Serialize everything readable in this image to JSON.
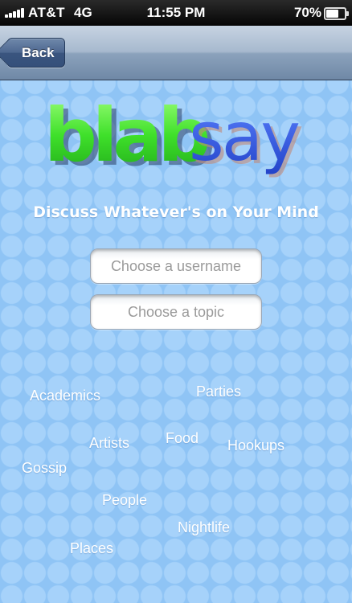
{
  "status_bar": {
    "carrier": "AT&T",
    "network": "4G",
    "time": "11:55 PM",
    "battery_percent": "70%",
    "battery_level": 0.7,
    "signal_bars": 5
  },
  "nav": {
    "back_label": "Back"
  },
  "logo": {
    "part1": "blab",
    "part2": "say",
    "colors": {
      "blab": "#3fe02a",
      "say": "#2f5ce0",
      "shadow": "#2a3f66"
    }
  },
  "tagline": "Discuss Whatever's on Your Mind",
  "form": {
    "username_placeholder": "Choose a username",
    "topic_placeholder": "Choose a topic"
  },
  "topics": [
    "Academics",
    "Parties",
    "Artists",
    "Food",
    "Hookups",
    "Gossip",
    "People",
    "Nightlife",
    "Places"
  ],
  "colors": {
    "background": "#8fc4f5",
    "dots": "#a6d2fa",
    "nav_bar": "#8ba2bc",
    "back_button": "#4d6790"
  }
}
